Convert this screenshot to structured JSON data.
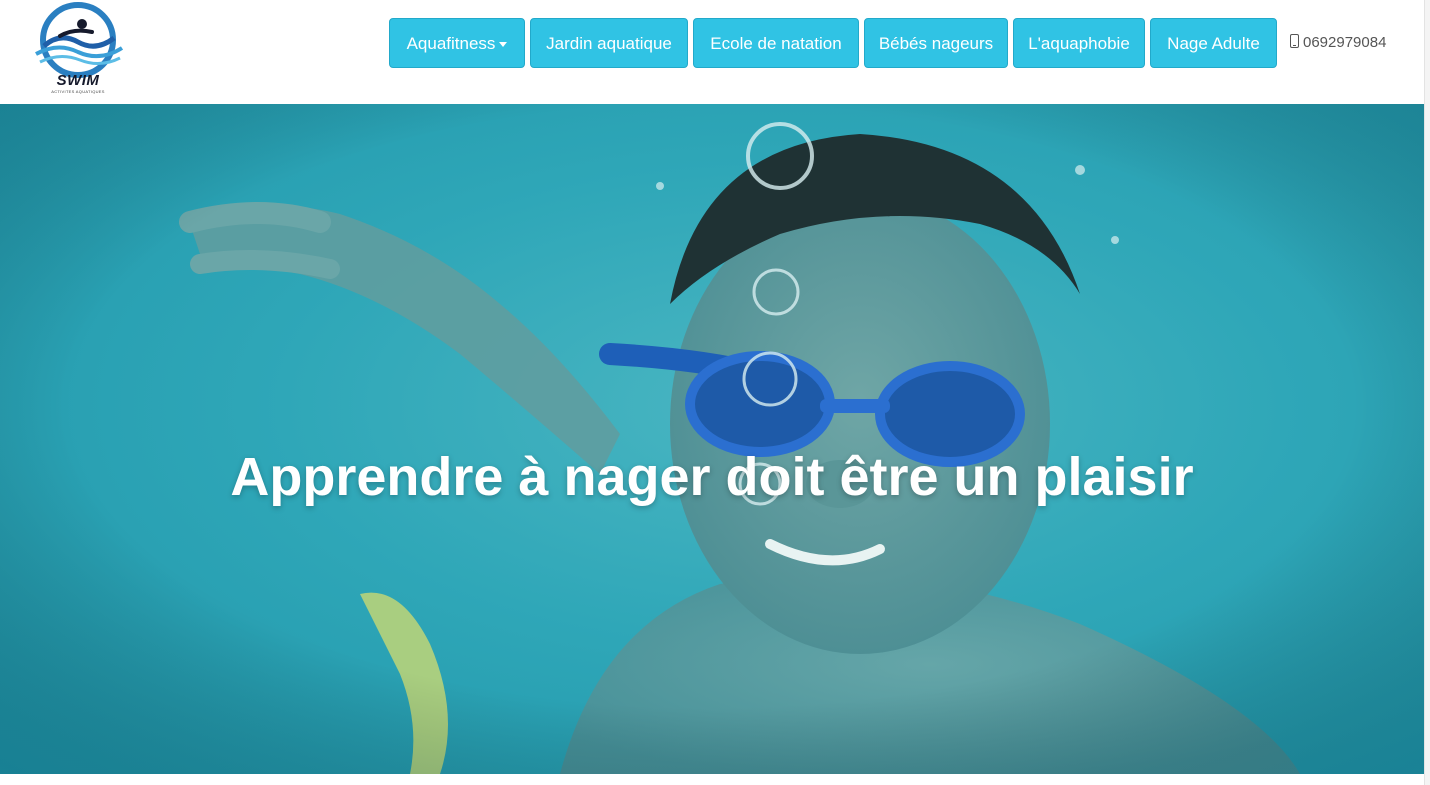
{
  "brand": {
    "name": "SWIM",
    "tagline": "ACTIVITES AQUATIQUES",
    "logo_icon": "swimmer-wave-logo"
  },
  "nav": {
    "items": [
      {
        "label": "Aquafitness",
        "has_dropdown": true
      },
      {
        "label": "Jardin aquatique",
        "has_dropdown": false
      },
      {
        "label": "Ecole de natation",
        "has_dropdown": false
      },
      {
        "label": "Bébés nageurs",
        "has_dropdown": false
      },
      {
        "label": "L'aquaphobie",
        "has_dropdown": false
      },
      {
        "label": "Nage Adulte",
        "has_dropdown": false
      }
    ],
    "phone": {
      "icon": "mobile-phone-icon",
      "number": "0692979084"
    }
  },
  "hero": {
    "title": "Apprendre à nager doit être un plaisir"
  },
  "colors": {
    "nav_button": "#30c3e4",
    "nav_button_border": "#22a9ca",
    "hero_water": "#2fa7b8",
    "hero_text": "#ffffff",
    "logo_blue": "#2a7fc1",
    "logo_dark": "#161a2c"
  }
}
